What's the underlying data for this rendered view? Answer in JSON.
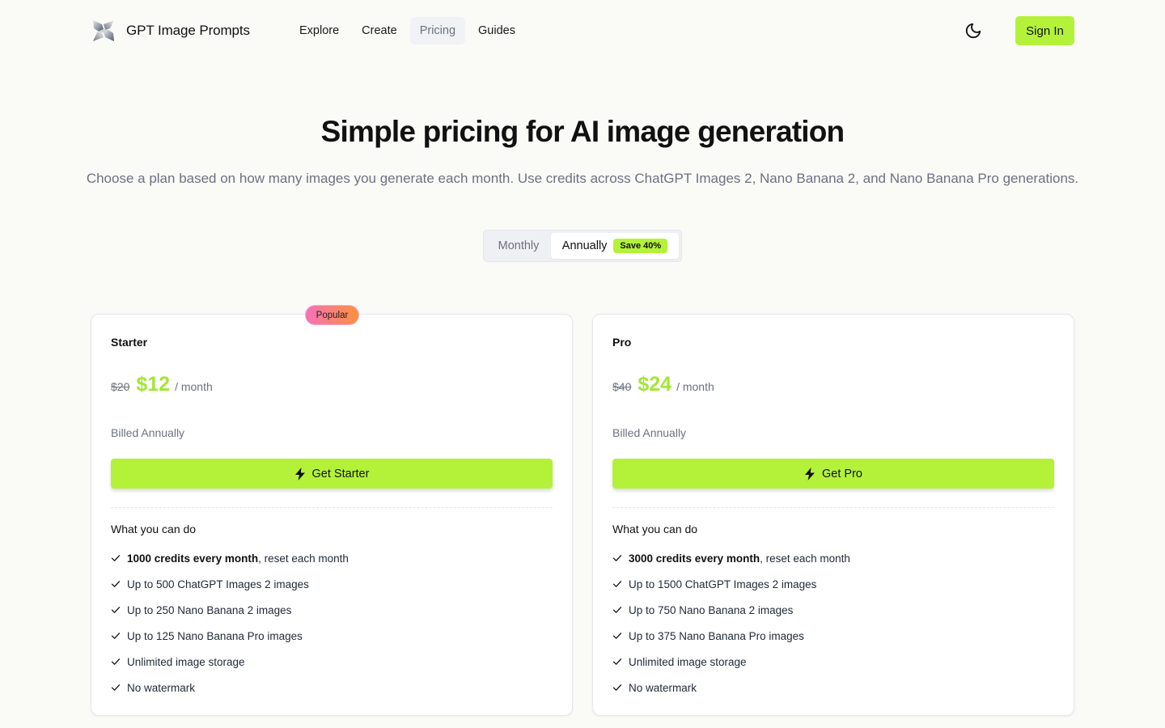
{
  "brand": {
    "name": "GPT Image Prompts",
    "logo_icon": "abstract-3d-logo-icon"
  },
  "nav": {
    "items": [
      {
        "label": "Explore",
        "active": false
      },
      {
        "label": "Create",
        "active": false
      },
      {
        "label": "Pricing",
        "active": true
      },
      {
        "label": "Guides",
        "active": false
      }
    ]
  },
  "header": {
    "theme_icon": "moon-icon",
    "signin_label": "Sign In"
  },
  "hero": {
    "title": "Simple pricing for AI image generation",
    "subtitle": "Choose a plan based on how many images you generate each month. Use credits across ChatGPT Images 2, Nano Banana 2, and Nano Banana Pro generations."
  },
  "billing": {
    "monthly_label": "Monthly",
    "annually_label": "Annually",
    "save_badge": "Save 40%",
    "selected": "Annually"
  },
  "plans": [
    {
      "name": "Starter",
      "badge": "Popular",
      "old_price": "$20",
      "price": "$12",
      "period": "/ month",
      "billed": "Billed Annually",
      "cta": "Get Starter",
      "features_title": "What you can do",
      "features": [
        {
          "bold": "1000 credits every month",
          "text": ", reset each month"
        },
        {
          "bold": "",
          "text": "Up to 500 ChatGPT Images 2 images"
        },
        {
          "bold": "",
          "text": "Up to 250 Nano Banana 2 images"
        },
        {
          "bold": "",
          "text": "Up to 125 Nano Banana Pro images"
        },
        {
          "bold": "",
          "text": "Unlimited image storage"
        },
        {
          "bold": "",
          "text": "No watermark"
        }
      ]
    },
    {
      "name": "Pro",
      "badge": "",
      "old_price": "$40",
      "price": "$24",
      "period": "/ month",
      "billed": "Billed Annually",
      "cta": "Get Pro",
      "features_title": "What you can do",
      "features": [
        {
          "bold": "3000 credits every month",
          "text": ", reset each month"
        },
        {
          "bold": "",
          "text": "Up to 1500 ChatGPT Images 2 images"
        },
        {
          "bold": "",
          "text": "Up to 750 Nano Banana 2 images"
        },
        {
          "bold": "",
          "text": "Up to 375 Nano Banana Pro images"
        },
        {
          "bold": "",
          "text": "Unlimited image storage"
        },
        {
          "bold": "",
          "text": "No watermark"
        }
      ]
    }
  ],
  "colors": {
    "accent": "#b4f23a",
    "price": "#a3e635",
    "muted": "#6b7280",
    "background": "#fafaf7"
  },
  "icons": {
    "cta_icon": "lightning-bolt-icon",
    "feature_icon": "check-icon"
  }
}
